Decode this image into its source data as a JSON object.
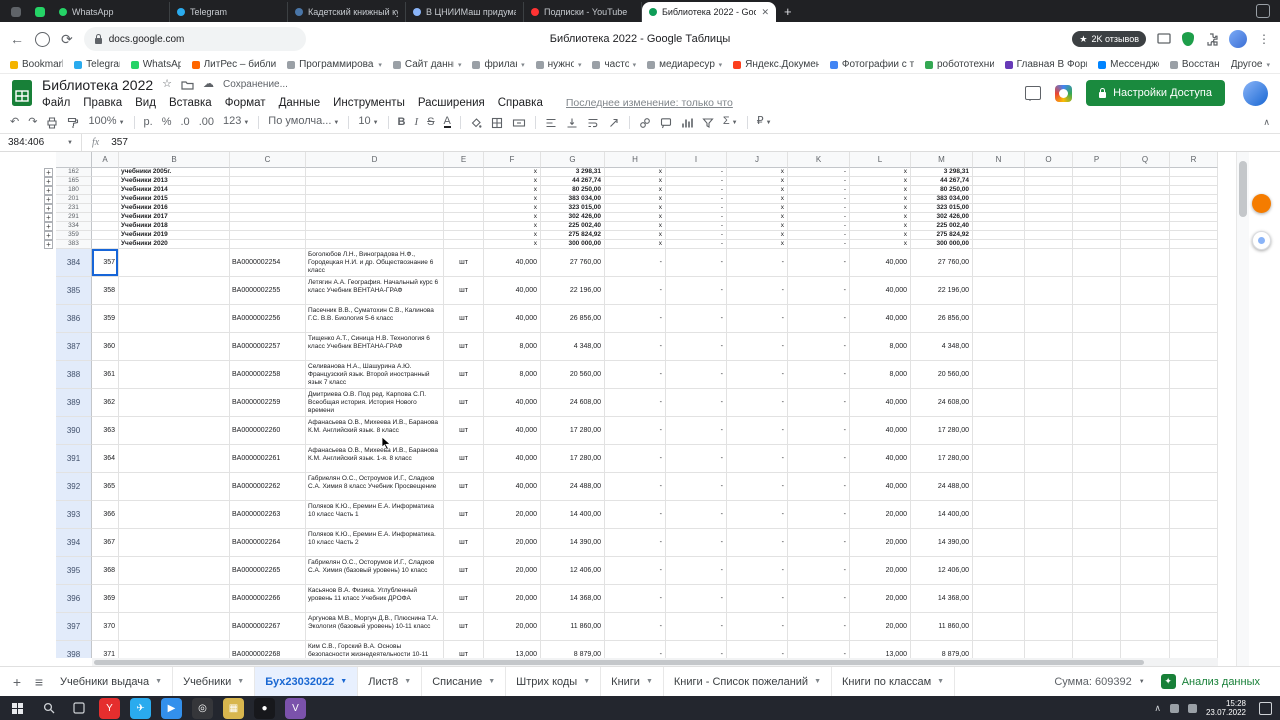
{
  "browser": {
    "pinned_tabs": [
      {
        "color": "#5f6368"
      },
      {
        "color": "#25d366"
      }
    ],
    "tabs": [
      {
        "label": "WhatsApp",
        "color": "#25d366"
      },
      {
        "label": "Telegram",
        "color": "#2aabee"
      },
      {
        "label": "Кадетский книжный кур...",
        "color": "#4a76a8"
      },
      {
        "label": "В ЦНИИМаш придумали...",
        "color": "#8ab4f8"
      },
      {
        "label": "Подписки - YouTube",
        "color": "#ff3333"
      },
      {
        "label": "Библиотека 2022 - Goo...",
        "color": "#0f9d58",
        "active": true
      }
    ],
    "url": "docs.google.com",
    "window_title": "Библиотека 2022 - Google Таблицы",
    "reviews_badge": "2K отзывов",
    "bookmarks": [
      {
        "label": "Bookmarks",
        "color": "#f4b400"
      },
      {
        "label": "Telegram",
        "color": "#2aabee"
      },
      {
        "label": "WhatsApp",
        "color": "#25d366"
      },
      {
        "label": "ЛитРес – библио...",
        "color": "#ff6600"
      },
      {
        "label": "Программирование",
        "color": "#9aa0a6",
        "folder": true
      },
      {
        "label": "Сайт данных",
        "color": "#9aa0a6",
        "folder": true
      },
      {
        "label": "фриланс",
        "color": "#9aa0a6",
        "folder": true
      },
      {
        "label": "нужное",
        "color": "#9aa0a6",
        "folder": true
      },
      {
        "label": "частое",
        "color": "#9aa0a6",
        "folder": true
      },
      {
        "label": "медиаресурсы",
        "color": "#9aa0a6",
        "folder": true
      },
      {
        "label": "Яндекс.Документ...",
        "color": "#fc3f1d"
      },
      {
        "label": "Фотографии с те...",
        "color": "#4285f4"
      },
      {
        "label": "робототехника",
        "color": "#34a853"
      },
      {
        "label": "Главная В Форм...",
        "color": "#673ab7"
      },
      {
        "label": "Мессенджер",
        "color": "#0084ff"
      },
      {
        "label": "Восстан...",
        "color": "#9aa0a6"
      }
    ],
    "bookmarks_other": "Другое"
  },
  "sheets": {
    "doc_title": "Библиотека 2022",
    "save_status": "Сохранение...",
    "menus": [
      "Файл",
      "Правка",
      "Вид",
      "Вставка",
      "Формат",
      "Данные",
      "Инструменты",
      "Расширения",
      "Справка"
    ],
    "last_edit": "Последнее изменение: только что",
    "share_button": "Настройки Доступа",
    "toolbar": {
      "zoom": "100%",
      "currency": "р.",
      "percent": "%",
      "dec_dec": ".0",
      "dec_inc": ".00",
      "more_formats": "123",
      "font": "По умолча...",
      "font_size": "10",
      "bold": "B",
      "italic": "I",
      "strike": "S",
      "text_color": "A",
      "functions": "Σ",
      "ruble": "₽"
    },
    "name_box": "384:406",
    "fx_label": "fx",
    "formula_value": "357"
  },
  "grid": {
    "columns": [
      "A",
      "B",
      "C",
      "D",
      "E",
      "F",
      "G",
      "H",
      "I",
      "J",
      "K",
      "L",
      "M",
      "N",
      "O",
      "P",
      "Q",
      "R"
    ],
    "group_rows": [
      {
        "row": "162",
        "label": "учебники 2005г.",
        "f": "x",
        "g": "3 298,31",
        "h": "x",
        "i": "-",
        "j": "x",
        "k": "-",
        "l": "x",
        "m": "3 298,31"
      },
      {
        "row": "165",
        "label": "Учебники 2013",
        "f": "x",
        "g": "44 267,74",
        "h": "x",
        "i": "-",
        "j": "x",
        "k": "-",
        "l": "x",
        "m": "44 267,74"
      },
      {
        "row": "180",
        "label": "Учебники 2014",
        "f": "x",
        "g": "80 250,00",
        "h": "x",
        "i": "-",
        "j": "x",
        "k": "-",
        "l": "x",
        "m": "80 250,00"
      },
      {
        "row": "201",
        "label": "Учебники 2015",
        "f": "x",
        "g": "383 034,00",
        "h": "x",
        "i": "-",
        "j": "x",
        "k": "-",
        "l": "x",
        "m": "383 034,00"
      },
      {
        "row": "231",
        "label": "Учебники 2016",
        "f": "x",
        "g": "323 015,00",
        "h": "x",
        "i": "-",
        "j": "x",
        "k": "-",
        "l": "x",
        "m": "323 015,00"
      },
      {
        "row": "291",
        "label": "Учебники 2017",
        "f": "x",
        "g": "302 426,00",
        "h": "x",
        "i": "-",
        "j": "x",
        "k": "-",
        "l": "x",
        "m": "302 426,00"
      },
      {
        "row": "334",
        "label": "Учебники 2018",
        "f": "x",
        "g": "225 002,40",
        "h": "x",
        "i": "-",
        "j": "x",
        "k": "-",
        "l": "x",
        "m": "225 002,40"
      },
      {
        "row": "359",
        "label": "Учебники 2019",
        "f": "x",
        "g": "275 824,92",
        "h": "x",
        "i": "-",
        "j": "x",
        "k": "-",
        "l": "x",
        "m": "275 824,92"
      },
      {
        "row": "383",
        "label": "Учебники 2020",
        "f": "x",
        "g": "300 000,00",
        "h": "x",
        "i": "-",
        "j": "x",
        "k": "-",
        "l": "x",
        "m": "300 000,00"
      }
    ],
    "data_rows": [
      {
        "row": "384",
        "a": "357",
        "c": "BA0000002254",
        "d": "Боголюбов Л.Н., Виноградова Н.Ф., Городецкая Н.И. и др. Обществознание 6 класс",
        "e": "шт",
        "f": "40,000",
        "g": "27 760,00",
        "h": "-",
        "i": "-",
        "j": "-",
        "k": "-",
        "l": "40,000",
        "m": "27 760,00",
        "selected": true
      },
      {
        "row": "385",
        "a": "358",
        "c": "BA0000002255",
        "d": "Летягин А.А. География. Начальный курс 6 класс Учебник ВЕНТАНА-ГРАФ",
        "e": "шт",
        "f": "40,000",
        "g": "22 196,00",
        "h": "-",
        "i": "-",
        "j": "-",
        "k": "-",
        "l": "40,000",
        "m": "22 196,00"
      },
      {
        "row": "386",
        "a": "359",
        "c": "BA0000002256",
        "d": "Пасечник В.В., Суматохин С.В., Калинова Г.С. В.В. Биология 5-6 класс",
        "e": "шт",
        "f": "40,000",
        "g": "26 856,00",
        "h": "-",
        "i": "-",
        "j": "-",
        "k": "-",
        "l": "40,000",
        "m": "26 856,00"
      },
      {
        "row": "387",
        "a": "360",
        "c": "BA0000002257",
        "d": "Тищенко А.Т., Синица Н.В. Технология 6 класс Учебник ВЕНТАНА-ГРАФ",
        "e": "шт",
        "f": "8,000",
        "g": "4 348,00",
        "h": "-",
        "i": "-",
        "j": "-",
        "k": "-",
        "l": "8,000",
        "m": "4 348,00"
      },
      {
        "row": "388",
        "a": "361",
        "c": "BA0000002258",
        "d": "Селиванова Н.А., Шашурина А.Ю. Французский язык. Второй иностранный язык 7 класс",
        "e": "шт",
        "f": "8,000",
        "g": "20 560,00",
        "h": "-",
        "i": "-",
        "j": "-",
        "k": "-",
        "l": "8,000",
        "m": "20 560,00"
      },
      {
        "row": "389",
        "a": "362",
        "c": "BA0000002259",
        "d": "Дмитриева О.В. Под ред. Карпова С.П. Всеобщая история. История Нового времени",
        "e": "шт",
        "f": "40,000",
        "g": "24 608,00",
        "h": "-",
        "i": "-",
        "j": "-",
        "k": "-",
        "l": "40,000",
        "m": "24 608,00"
      },
      {
        "row": "390",
        "a": "363",
        "c": "BA0000002260",
        "d": "Афанасьева О.В., Михеева И.В., Баранова К.М. Английский язык. 8 класс",
        "e": "шт",
        "f": "40,000",
        "g": "17 280,00",
        "h": "-",
        "i": "-",
        "j": "-",
        "k": "-",
        "l": "40,000",
        "m": "17 280,00"
      },
      {
        "row": "391",
        "a": "364",
        "c": "BA0000002261",
        "d": "Афанасьева О.В., Михеева И.В., Баранова К.М. Английский язык. 1-я. 8 класс",
        "e": "шт",
        "f": "40,000",
        "g": "17 280,00",
        "h": "-",
        "i": "-",
        "j": "-",
        "k": "-",
        "l": "40,000",
        "m": "17 280,00"
      },
      {
        "row": "392",
        "a": "365",
        "c": "BA0000002262",
        "d": "Габриелян О.С., Остроумов И.Г., Сладков С.А. Химия 8 класс Учебник Просвещение",
        "e": "шт",
        "f": "40,000",
        "g": "24 488,00",
        "h": "-",
        "i": "-",
        "j": "-",
        "k": "-",
        "l": "40,000",
        "m": "24 488,00"
      },
      {
        "row": "393",
        "a": "366",
        "c": "BA0000002263",
        "d": "Поляков К.Ю., Еремин Е.А. Информатика 10 класс Часть 1",
        "e": "шт",
        "f": "20,000",
        "g": "14 400,00",
        "h": "-",
        "i": "-",
        "j": "-",
        "k": "-",
        "l": "20,000",
        "m": "14 400,00"
      },
      {
        "row": "394",
        "a": "367",
        "c": "BA0000002264",
        "d": "Поляков К.Ю., Еремин Е.А. Информатика. 10 класс Часть 2",
        "e": "шт",
        "f": "20,000",
        "g": "14 390,00",
        "h": "-",
        "i": "-",
        "j": "-",
        "k": "-",
        "l": "20,000",
        "m": "14 390,00"
      },
      {
        "row": "395",
        "a": "368",
        "c": "BA0000002265",
        "d": "Габриелян О.С., Осторумов И.Г., Сладков С.А. Химия (базовый уровень) 10 класс",
        "e": "шт",
        "f": "20,000",
        "g": "12 406,00",
        "h": "-",
        "i": "-",
        "j": "-",
        "k": "-",
        "l": "20,000",
        "m": "12 406,00"
      },
      {
        "row": "396",
        "a": "369",
        "c": "BA0000002266",
        "d": "Касьянов В.А. Физика. Углубленный уровень 11 класс Учебник ДРОФА",
        "e": "шт",
        "f": "20,000",
        "g": "14 368,00",
        "h": "-",
        "i": "-",
        "j": "-",
        "k": "-",
        "l": "20,000",
        "m": "14 368,00"
      },
      {
        "row": "397",
        "a": "370",
        "c": "BA0000002267",
        "d": "Аргунова М.В., Моргун Д.В., Плюснина Т.А.    Экология (базовый уровень) 10-11 класс",
        "e": "шт",
        "f": "20,000",
        "g": "11 860,00",
        "h": "-",
        "i": "-",
        "j": "-",
        "k": "-",
        "l": "20,000",
        "m": "11 860,00"
      },
      {
        "row": "398",
        "a": "371",
        "c": "BA0000002268",
        "d": "Ким С.В., Горский В.А. Основы безопасности жизнедеятельности 10-11 класс",
        "e": "шт",
        "f": "13,000",
        "g": "8 879,00",
        "h": "-",
        "i": "-",
        "j": "-",
        "k": "-",
        "l": "13,000",
        "m": "8 879,00"
      }
    ]
  },
  "sheet_tabs": {
    "tabs": [
      {
        "label": "Учебники выдача"
      },
      {
        "label": "Учебники"
      },
      {
        "label": "Бух23032022",
        "active": true
      },
      {
        "label": "Лист8"
      },
      {
        "label": "Списание"
      },
      {
        "label": "Штрих коды"
      },
      {
        "label": "Книги"
      },
      {
        "label": "Книги - Список пожеланий"
      },
      {
        "label": "Книги по классам"
      }
    ],
    "sum_label": "Сумма: 609392",
    "explore_label": "Анализ данных"
  },
  "taskbar": {
    "apps": [
      {
        "color": "#e52e2e",
        "glyph": "Y"
      },
      {
        "color": "#2aabee",
        "glyph": "✈"
      },
      {
        "color": "#3390ec",
        "glyph": "▶"
      },
      {
        "color": "#35363a",
        "glyph": "◎"
      },
      {
        "color": "#d8b64e",
        "glyph": "▦"
      },
      {
        "color": "#17181c",
        "glyph": "●"
      },
      {
        "color": "#7b52ab",
        "glyph": "V"
      }
    ],
    "time": "15:28",
    "date": "23.07.2022"
  }
}
